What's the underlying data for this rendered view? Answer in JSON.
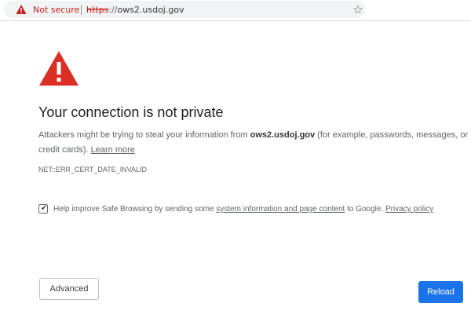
{
  "address_bar": {
    "security_label": "Not secure",
    "url_scheme": "https",
    "url_separator": "://",
    "url_host": "ows2.usdoj.gov"
  },
  "interstitial": {
    "heading": "Your connection is not private",
    "description_before": "Attackers might be trying to steal your information from ",
    "description_host": "ows2.usdoj.gov",
    "description_after": " (for example, passwords, messages, or credit cards). ",
    "learn_more_link": "Learn more",
    "error_code": "NET::ERR_CERT_DATE_INVALID"
  },
  "safe_browsing": {
    "checked": true,
    "check_glyph": "✔",
    "label_before": "Help improve Safe Browsing by sending some ",
    "system_info_link": "system information and page content",
    "label_middle": " to Google. ",
    "privacy_link": "Privacy policy"
  },
  "buttons": {
    "advanced": "Advanced",
    "reload": "Reload"
  },
  "icons": {
    "security_warning": "warning-triangle-icon",
    "bookmark": "star-icon",
    "star_glyph": "☆",
    "page_warning": "warning-triangle-icon"
  },
  "colors": {
    "warning_red": "#d93025",
    "not_secure_red": "#c5221f",
    "primary_blue": "#1a73e8",
    "text_gray": "#5f6368"
  }
}
